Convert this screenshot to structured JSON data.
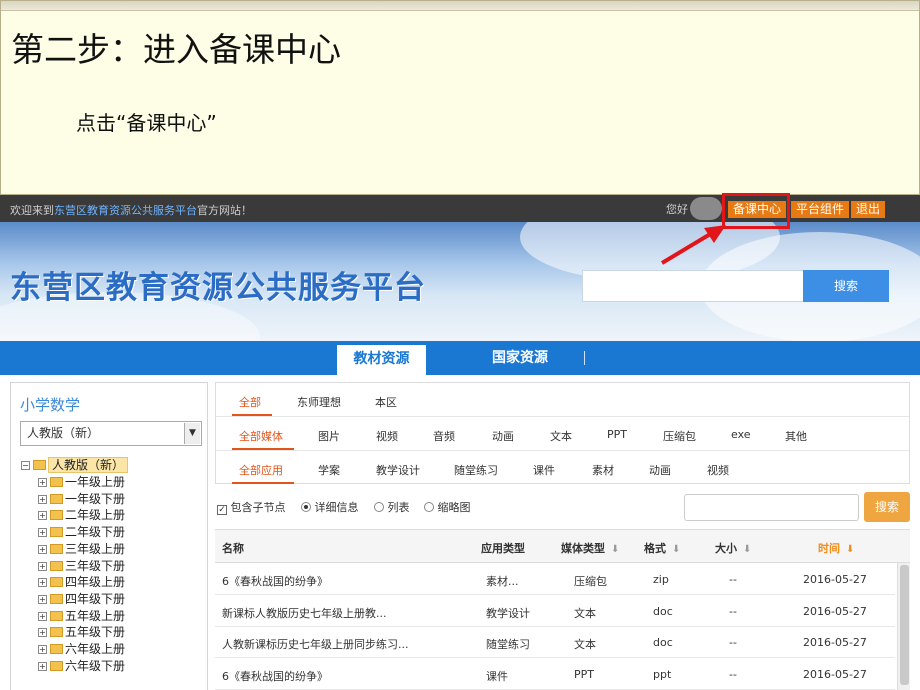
{
  "instruction": {
    "title": "第二步：进入备课中心",
    "description": "点击“备课中心”"
  },
  "topbar": {
    "welcome_prefix": "欢迎来到",
    "welcome_site": "东营区教育资源公共服务平台",
    "welcome_suffix": "官方网站！",
    "hello": "您好",
    "buttons": [
      "备课中心",
      "平台组件",
      "退出"
    ]
  },
  "banner": {
    "site_title": "东营区教育资源公共服务平台",
    "search_button": "搜索",
    "search_value": ""
  },
  "nav": {
    "tabs": [
      "教材资源",
      "国家资源"
    ]
  },
  "sidebar": {
    "subject": "小学数学",
    "edition_select": "人教版（新）",
    "tree_root": "人教版（新）",
    "grades": [
      "一年级上册",
      "一年级下册",
      "二年级上册",
      "二年级下册",
      "三年级上册",
      "三年级下册",
      "四年级上册",
      "四年级下册",
      "五年级上册",
      "五年级下册",
      "六年级上册",
      "六年级下册"
    ]
  },
  "filters": {
    "scope": [
      "全部",
      "东师理想",
      "本区"
    ],
    "media": [
      "全部媒体",
      "图片",
      "视频",
      "音频",
      "动画",
      "文本",
      "PPT",
      "压缩包",
      "exe",
      "其他"
    ],
    "application": [
      "全部应用",
      "学案",
      "教学设计",
      "随堂练习",
      "课件",
      "素材",
      "动画",
      "视频"
    ]
  },
  "options": {
    "include_children": "包含子节点",
    "detail": "详细信息",
    "list": "列表",
    "thumbnail": "缩略图",
    "search_button": "搜索",
    "search_value": ""
  },
  "table": {
    "headers": {
      "name": "名称",
      "app_type": "应用类型",
      "media_type": "媒体类型",
      "format": "格式",
      "size": "大小",
      "time": "时间"
    },
    "rows": [
      {
        "name": "6《春秋战国的纷争》",
        "app_type": "素材...",
        "media_type": "压缩包",
        "format": "zip",
        "size": "--",
        "time": "2016-05-27"
      },
      {
        "name": "新课标人教版历史七年级上册教...",
        "app_type": "教学设计",
        "media_type": "文本",
        "format": "doc",
        "size": "--",
        "time": "2016-05-27"
      },
      {
        "name": "人教新课标历史七年级上册同步练习...",
        "app_type": "随堂练习",
        "media_type": "文本",
        "format": "doc",
        "size": "--",
        "time": "2016-05-27"
      },
      {
        "name": "6《春秋战国的纷争》",
        "app_type": "课件",
        "media_type": "PPT",
        "format": "ppt",
        "size": "--",
        "time": "2016-05-27"
      }
    ]
  },
  "colors": {
    "accent_orange": "#e77a13",
    "nav_blue": "#1a77d2",
    "highlight_red": "#e2151a"
  }
}
